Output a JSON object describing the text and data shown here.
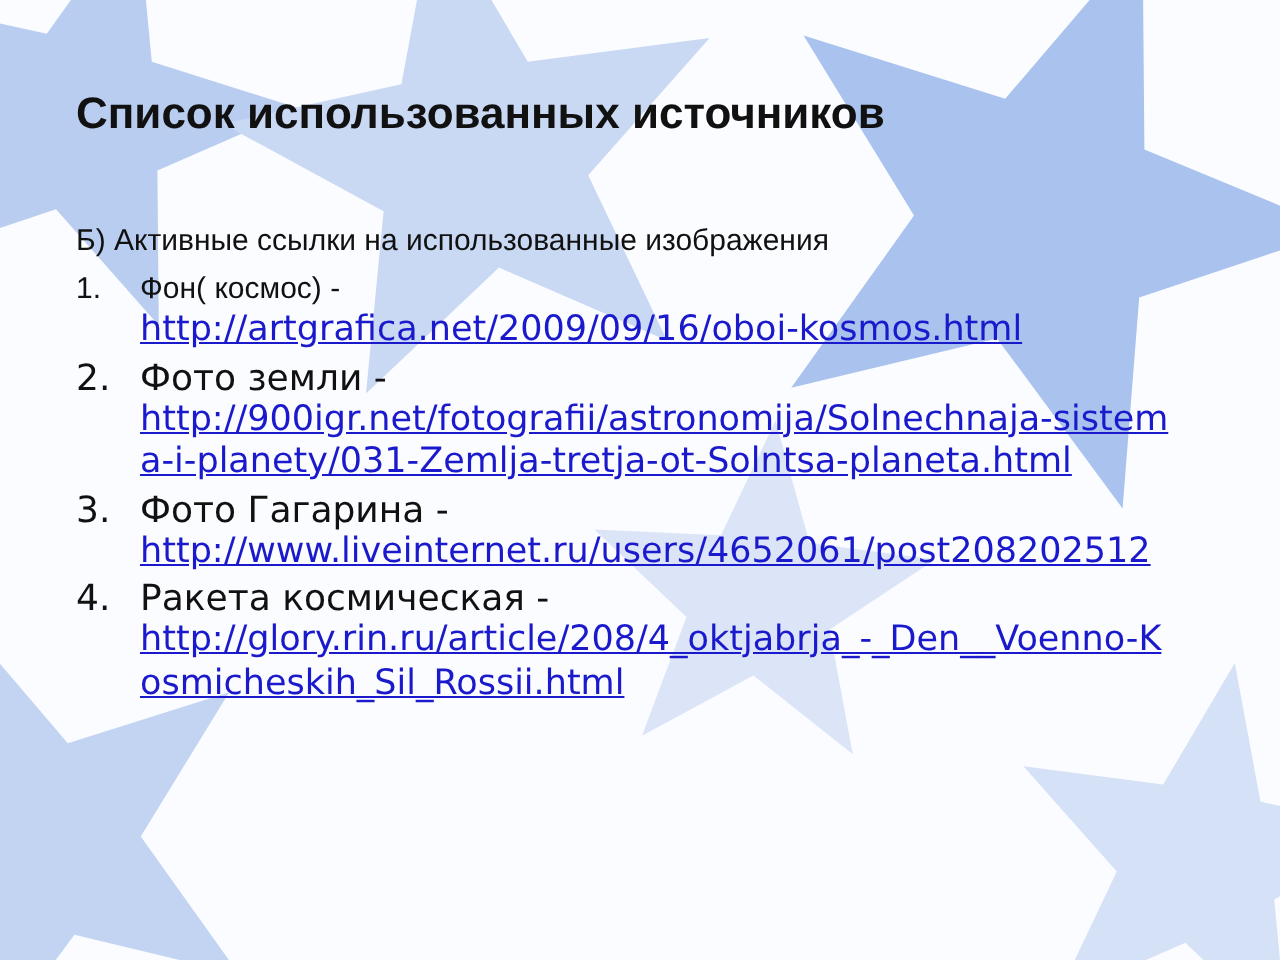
{
  "slide": {
    "title": "Список использованных источников",
    "subtitle": "Б) Активные ссылки на использованные изображения",
    "items": [
      {
        "number": "1.",
        "kind": "compact",
        "label": "Фон( космос) -",
        "url": "http://artgrafica.net/2009/09/16/oboi-kosmos.html"
      },
      {
        "number": "2.",
        "kind": "regular",
        "label": "Фото земли -",
        "url": "http://900igr.net/fotografii/astronomija/Solnechnaja-sistema-i-planety/031-Zemlja-tretja-ot-Solntsa-planeta.html"
      },
      {
        "number": "3.",
        "kind": "regular",
        "label": "Фото Гагарина -",
        "url": "http://www.liveinternet.ru/users/4652061/post208202512"
      },
      {
        "number": "4.",
        "kind": "regular",
        "label": "Ракета космическая -",
        "url": "http://glory.rin.ru/article/208/4_oktjabrja_-_Den__Voenno-Kosmicheskih_Sil_Rossii.html"
      }
    ]
  }
}
